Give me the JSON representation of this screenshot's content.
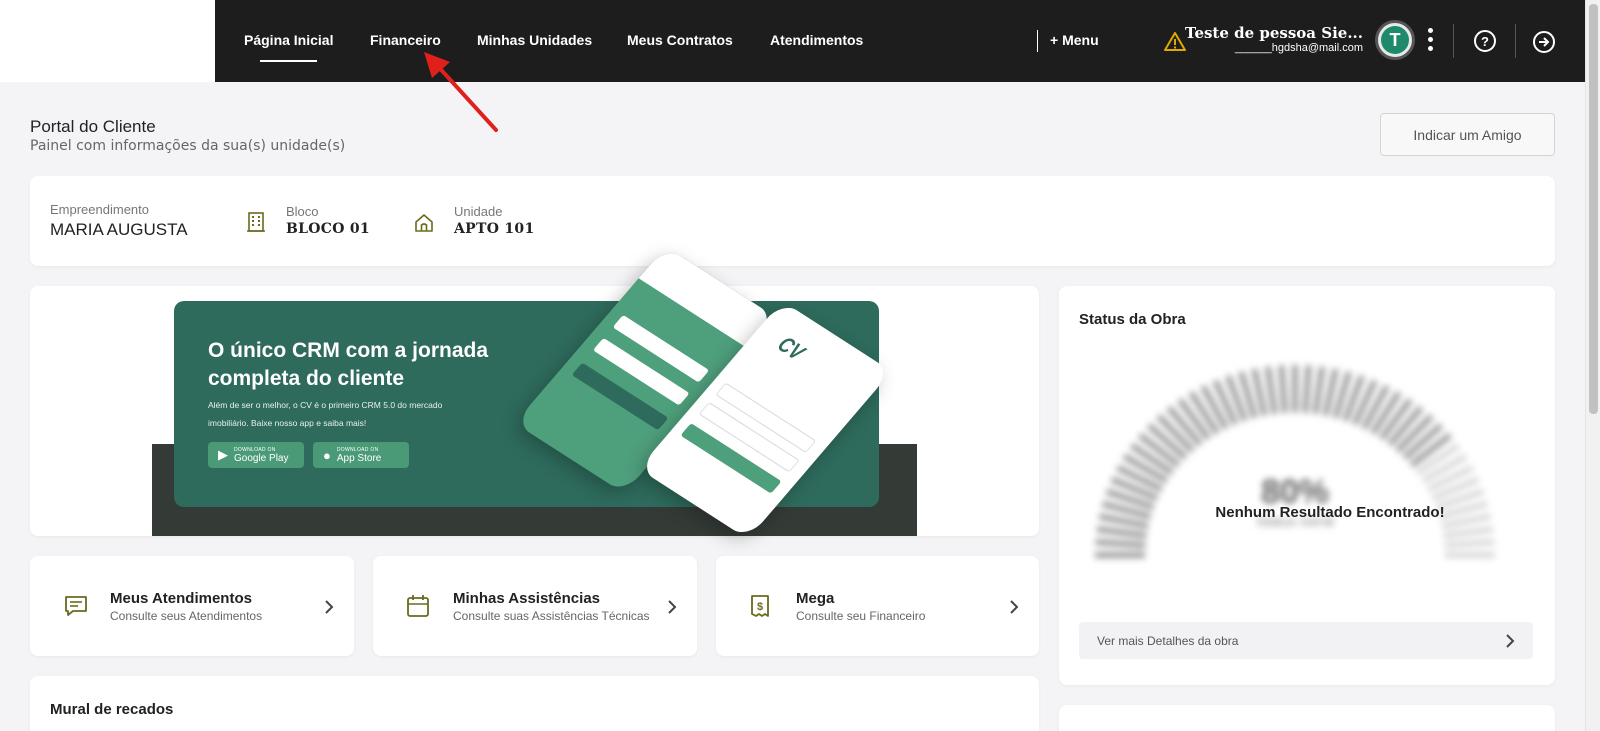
{
  "nav": {
    "items": [
      {
        "label": "Página Inicial",
        "active": true
      },
      {
        "label": "Financeiro"
      },
      {
        "label": "Minhas Unidades"
      },
      {
        "label": "Meus Contratos"
      },
      {
        "label": "Atendimentos"
      }
    ],
    "menu_label": "+ Menu"
  },
  "user": {
    "name": "Teste de pessoa Sie...",
    "email": "______hgdsha@mail.com",
    "avatar_letter": "T"
  },
  "icons": {
    "help": "help-circle-icon",
    "logout": "logout-icon",
    "warning": "warning-icon"
  },
  "header": {
    "title": "Portal do Cliente",
    "subtitle": "Painel com informações da sua(s) unidade(s)",
    "indicate_button": "Indicar um Amigo"
  },
  "info": {
    "empreendimento_label": "Empreendimento",
    "empreendimento_value": "MARIA AUGUSTA",
    "bloco_label": "Bloco",
    "bloco_value": "BLOCO 01",
    "unidade_label": "Unidade",
    "unidade_value": "APTO 101"
  },
  "banner": {
    "title": "O único CRM com a jornada completa do cliente",
    "text": "Além de ser o melhor, o CV é o primeiro CRM 5.0 do mercado imobiliário. Baixe nosso app e saiba mais!",
    "google_small": "DOWNLOAD ON",
    "google_big": "Google Play",
    "apple_small": "DOWNLOAD ON",
    "apple_big": "App Store",
    "logo_text": "CV"
  },
  "quick_cards": [
    {
      "title": "Meus Atendimentos",
      "subtitle": "Consulte seus Atendimentos",
      "icon": "chat-icon"
    },
    {
      "title": "Minhas Assistências",
      "subtitle": "Consulte suas Assistências Técnicas",
      "icon": "calendar-icon"
    },
    {
      "title": "Mega",
      "subtitle": "Consulte seu Financeiro",
      "icon": "receipt-icon"
    }
  ],
  "status": {
    "title": "Status da Obra",
    "percent": "80%",
    "gauge_label": "Status Geral",
    "no_result": "Nenhum Resultado Encontrado!",
    "details_link": "Ver mais Detalhes da obra"
  },
  "mural": {
    "title": "Mural de recados"
  },
  "colors": {
    "topbar": "#1d1d1d",
    "brand_green": "#2e6b5c",
    "icon_olive": "#6b6a1e",
    "warning": "#e0a800"
  }
}
